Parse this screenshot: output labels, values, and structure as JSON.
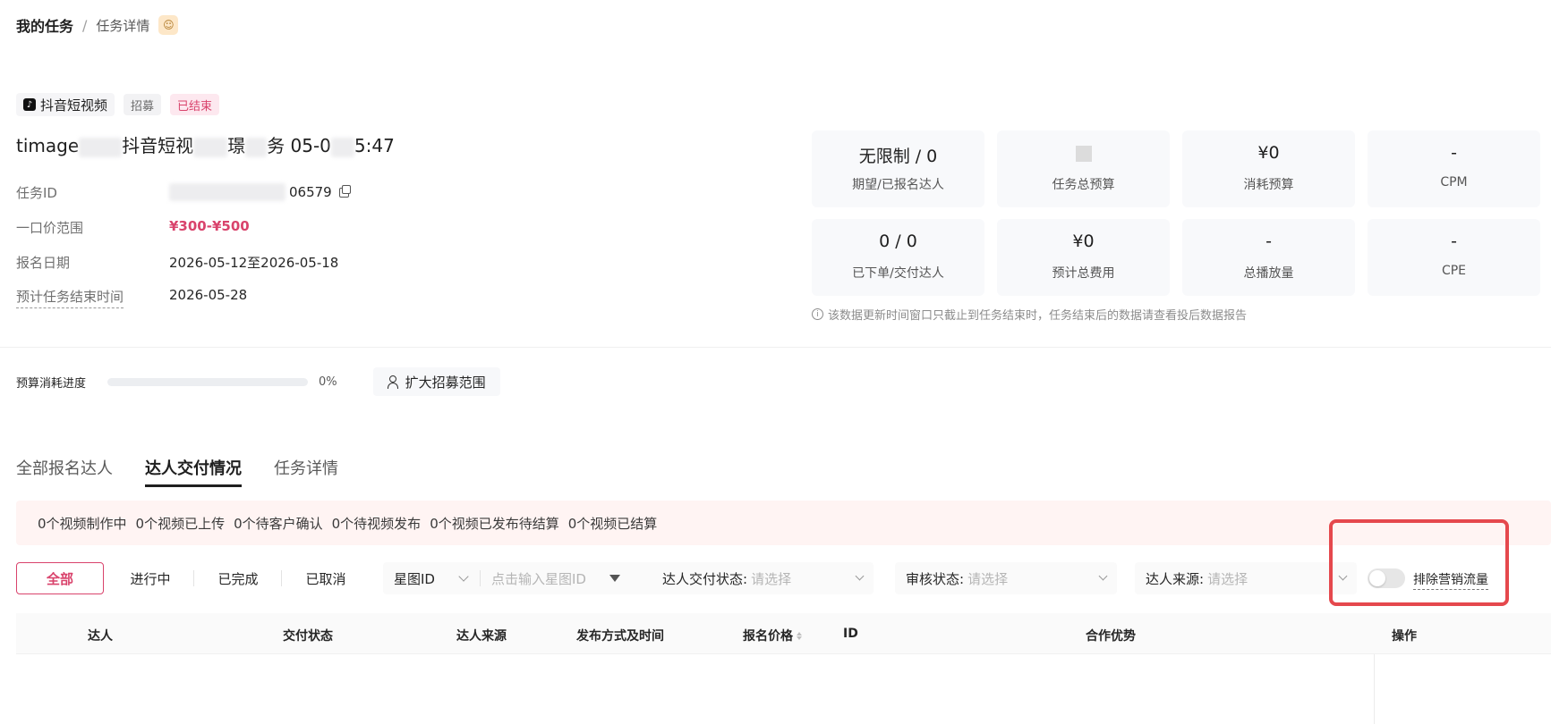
{
  "breadcrumb": {
    "root": "我的任务",
    "separator": "/",
    "current": "任务详情",
    "avatar_icon": "avatar-icon"
  },
  "tags": {
    "platform": "抖音短视频",
    "platform_icon": "douyin-icon",
    "type": "招募",
    "status": "已结束"
  },
  "task": {
    "title_prefix": "timage",
    "title_mid1": "抖音短视",
    "title_mid2": "璟",
    "title_mid3": "务 05-0",
    "title_suffix": "5:47"
  },
  "info": [
    {
      "label": "任务ID",
      "value": "06579",
      "copyable": true
    },
    {
      "label": "一口价范围",
      "value": "¥300-¥500",
      "highlight": true
    },
    {
      "label": "报名日期",
      "value": "2026-05-12至2026-05-18"
    },
    {
      "label": "预计任务结束时间",
      "value": "2026-05-28",
      "dashed": true
    }
  ],
  "stats": [
    {
      "value": "无限制 / 0",
      "label": "期望/已报名达人"
    },
    {
      "value": "",
      "label": "任务总预算",
      "placeholder": true
    },
    {
      "value": "¥0",
      "label": "消耗预算"
    },
    {
      "value": "-",
      "label": "CPM"
    },
    {
      "value": "0 / 0",
      "label": "已下单/交付达人"
    },
    {
      "value": "¥0",
      "label": "预计总费用"
    },
    {
      "value": "-",
      "label": "总播放量"
    },
    {
      "value": "-",
      "label": "CPE"
    }
  ],
  "stats_note": "该数据更新时间窗口只截止到任务结束时，任务结束后的数据请查看投后数据报告",
  "budget": {
    "label": "预算消耗进度",
    "percent_text": "0%",
    "progress": 0,
    "expand_button": "扩大招募范围"
  },
  "tabs": [
    {
      "label": "全部报名达人",
      "active": false
    },
    {
      "label": "达人交付情况",
      "active": true
    },
    {
      "label": "任务详情",
      "active": false
    }
  ],
  "banner": [
    "0个视频制作中",
    "0个视频已上传",
    "0个待客户确认",
    "0个待视频发布",
    "0个视频已发布待结算",
    "0个视频已结算"
  ],
  "filters": {
    "segments": [
      "全部",
      "进行中",
      "已完成",
      "已取消"
    ],
    "id_select": "星图ID",
    "id_placeholder": "点击输入星图ID",
    "delivery_label": "达人交付状态:",
    "review_label": "审核状态:",
    "source_label": "达人来源:",
    "select_placeholder": "请选择",
    "toggle_label": "排除营销流量",
    "toggle_on": false
  },
  "table": {
    "columns": [
      "达人",
      "交付状态",
      "达人来源",
      "发布方式及时间",
      "报名价格",
      "ID",
      "合作优势",
      "操作"
    ]
  },
  "colors": {
    "accent": "#d9436c",
    "highlight_box": "#e5484d",
    "banner_bg": "#fff4f3"
  }
}
